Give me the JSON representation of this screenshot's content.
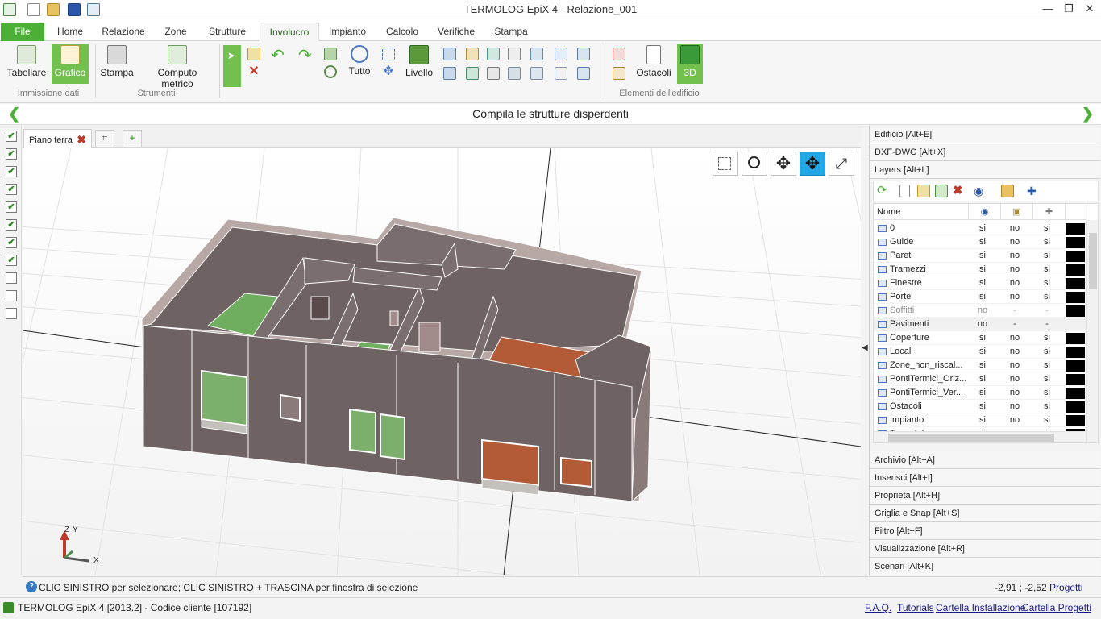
{
  "window": {
    "title": "TERMOLOG EpiX 4 - Relazione_001",
    "min_label": "—",
    "max_label": "❐",
    "close_label": "✕"
  },
  "menu_tabs": [
    "File",
    "Home",
    "Relazione",
    "Zone",
    "Strutture",
    "Involucro",
    "Impianto",
    "Calcolo",
    "Verifiche",
    "Stampa"
  ],
  "ribbon": {
    "tabellare": "Tabellare",
    "grafico": "Grafico",
    "stampa": "Stampa",
    "computo": "Computo metrico",
    "tutto": "Tutto",
    "livello": "Livello",
    "ostacoli": "Ostacoli",
    "view3d": "3D",
    "group_immissione": "Immissione dati",
    "group_strumenti": "Strumenti",
    "group_elementi": "Elementi dell'edificio"
  },
  "subbar": {
    "title": "Compila le strutture disperdenti",
    "prev": "❮",
    "next": "❯"
  },
  "doc_tabs": {
    "active": "Piano terra",
    "close": "✖"
  },
  "axis": {
    "z": "Z",
    "y": "Y",
    "x": "X"
  },
  "panels": {
    "edificio": "Edificio [Alt+E]",
    "dxf": "DXF-DWG [Alt+X]",
    "layers": "Layers [Alt+L]",
    "archivio": "Archivio [Alt+A]",
    "inserisci": "Inserisci [Alt+I]",
    "proprieta": "Proprietà [Alt+H]",
    "griglia": "Griglia e Snap [Alt+S]",
    "filtro": "Filtro [Alt+F]",
    "visualizzazione": "Visualizzazione [Alt+R]",
    "scenari": "Scenari [Alt+K]"
  },
  "layers": {
    "col_name": "Nome",
    "rows": [
      {
        "name": "0",
        "v": "si",
        "l": "no",
        "s": "si",
        "swatch": true
      },
      {
        "name": "Guide",
        "v": "si",
        "l": "no",
        "s": "si",
        "swatch": true
      },
      {
        "name": "Pareti",
        "v": "si",
        "l": "no",
        "s": "si",
        "swatch": true
      },
      {
        "name": "Tramezzi",
        "v": "si",
        "l": "no",
        "s": "si",
        "swatch": true
      },
      {
        "name": "Finestre",
        "v": "si",
        "l": "no",
        "s": "si",
        "swatch": true
      },
      {
        "name": "Porte",
        "v": "si",
        "l": "no",
        "s": "si",
        "swatch": true
      },
      {
        "name": "Soffitti",
        "v": "no",
        "l": "-",
        "s": "-",
        "swatch": true,
        "dim": true
      },
      {
        "name": "Pavimenti",
        "v": "no",
        "l": "-",
        "s": "-",
        "swatch": false,
        "sel": true
      },
      {
        "name": "Coperture",
        "v": "si",
        "l": "no",
        "s": "si",
        "swatch": true
      },
      {
        "name": "Locali",
        "v": "si",
        "l": "no",
        "s": "si",
        "swatch": true
      },
      {
        "name": "Zone_non_riscal...",
        "v": "si",
        "l": "no",
        "s": "si",
        "swatch": true
      },
      {
        "name": "PontiTermici_Oriz...",
        "v": "si",
        "l": "no",
        "s": "si",
        "swatch": true
      },
      {
        "name": "PontiTermici_Ver...",
        "v": "si",
        "l": "no",
        "s": "si",
        "swatch": true
      },
      {
        "name": "Ostacoli",
        "v": "si",
        "l": "no",
        "s": "si",
        "swatch": true
      },
      {
        "name": "Impianto",
        "v": "si",
        "l": "no",
        "s": "si",
        "swatch": true
      },
      {
        "name": "Termotab...",
        "v": "si",
        "l": "no",
        "s": "si",
        "swatch": true
      }
    ]
  },
  "status": {
    "help": "?",
    "message": "CLIC SINISTRO per selezionare; CLIC SINISTRO + TRASCINA per finestra di selezione",
    "coords": "-2,91 ; -2,52",
    "progetti": "Progetti"
  },
  "footer": {
    "app": "TERMOLOG EpiX 4 [2013.2] - Codice cliente [107192]",
    "faq": "F.A.Q.",
    "tutorials": "Tutorials",
    "cartella_inst": "Cartella Installazione",
    "cartella_prog": "Cartella Progetti"
  },
  "colors": {
    "accent": "#4caf36",
    "active3d": "#22a7e6",
    "wall": "#6e6262",
    "floor_green": "#6fae5f",
    "floor_orange": "#b35a36"
  }
}
